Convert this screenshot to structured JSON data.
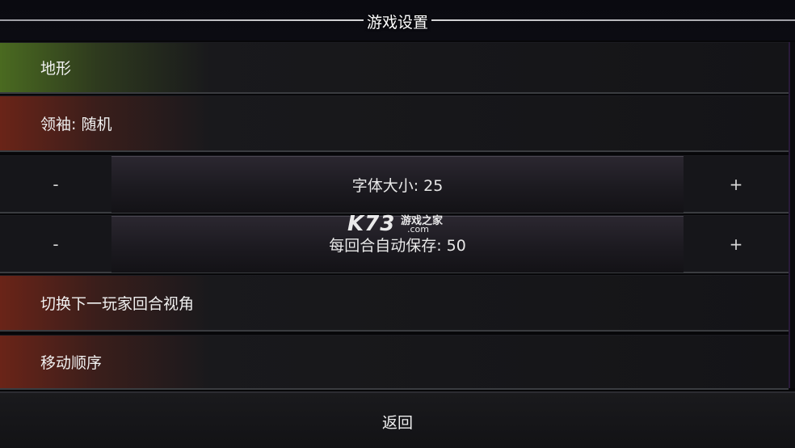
{
  "header": {
    "title": "游戏设置"
  },
  "menu": {
    "terrain": "地形",
    "leader": "领袖: 随机",
    "switch_view": "切换下一玩家回合视角",
    "move_order": "移动顺序"
  },
  "font_size": {
    "label": "字体大小: 25",
    "minus": "-",
    "plus": "+"
  },
  "autosave": {
    "label": "每回合自动保存: 50",
    "minus": "-",
    "plus": "+"
  },
  "footer": {
    "back": "返回"
  },
  "watermark": {
    "logo": "K73",
    "cn": "游戏之家",
    "com": ".com"
  },
  "colors": {
    "terrain_accent": "#4a6a20",
    "red_accent": "#6a2418"
  }
}
